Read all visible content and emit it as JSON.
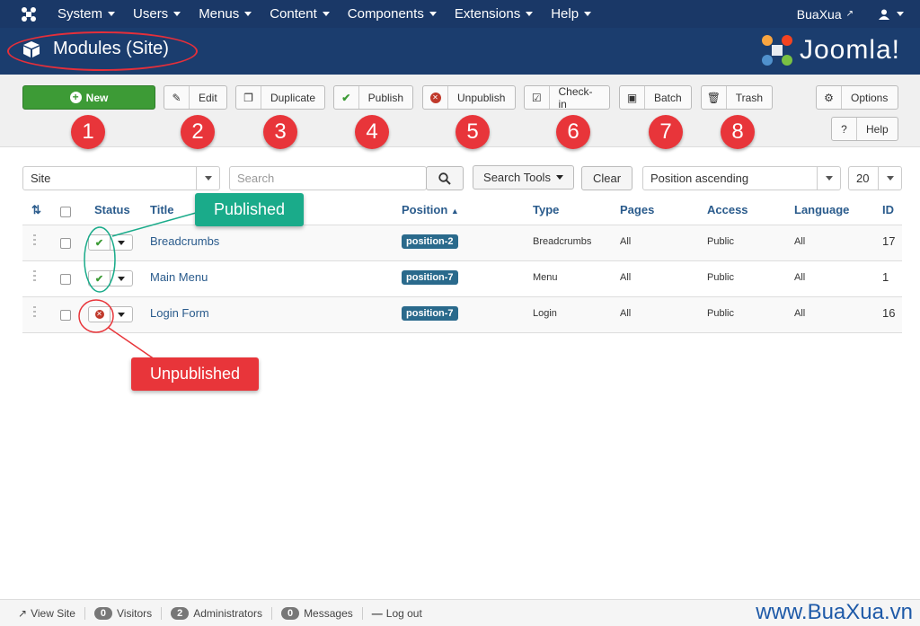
{
  "nav": {
    "items": [
      "System",
      "Users",
      "Menus",
      "Content",
      "Components",
      "Extensions",
      "Help"
    ],
    "user_link": "BuaXua"
  },
  "header": {
    "title": "Modules (Site)",
    "brand": "Joomla!"
  },
  "toolbar": {
    "new": "New",
    "edit": "Edit",
    "duplicate": "Duplicate",
    "publish": "Publish",
    "unpublish": "Unpublish",
    "checkin": "Check-in",
    "batch": "Batch",
    "trash": "Trash",
    "options": "Options",
    "help": "Help"
  },
  "annotations": {
    "numbers": [
      "1",
      "2",
      "3",
      "4",
      "5",
      "6",
      "7",
      "8"
    ],
    "published": "Published",
    "unpublished": "Unpublished"
  },
  "filters": {
    "client": "Site",
    "search_placeholder": "Search",
    "search_tools": "Search Tools",
    "clear": "Clear",
    "ordering": "Position ascending",
    "limit": "20"
  },
  "table": {
    "headers": {
      "status": "Status",
      "title": "Title",
      "position": "Position",
      "type": "Type",
      "pages": "Pages",
      "access": "Access",
      "language": "Language",
      "id": "ID"
    },
    "rows": [
      {
        "title": "Breadcrumbs",
        "position": "position-2",
        "type": "Breadcrumbs",
        "pages": "All",
        "access": "Public",
        "language": "All",
        "id": "17",
        "published": true
      },
      {
        "title": "Main Menu",
        "position": "position-7",
        "type": "Menu",
        "pages": "All",
        "access": "Public",
        "language": "All",
        "id": "1",
        "published": true
      },
      {
        "title": "Login Form",
        "position": "position-7",
        "type": "Login",
        "pages": "All",
        "access": "Public",
        "language": "All",
        "id": "16",
        "published": false
      }
    ]
  },
  "footer": {
    "view_site": "View Site",
    "visitors_count": "0",
    "visitors": "Visitors",
    "admins_count": "2",
    "admins": "Administrators",
    "messages_count": "0",
    "messages": "Messages",
    "logout": "Log out",
    "watermark": "www.BuaXua.vn"
  },
  "colors": {
    "nav_bg": "#1a3867",
    "header_bg": "#1b3d6e",
    "new_button": "#3d9b36",
    "badge_red": "#e8353a",
    "callout_green": "#1aab8a"
  }
}
